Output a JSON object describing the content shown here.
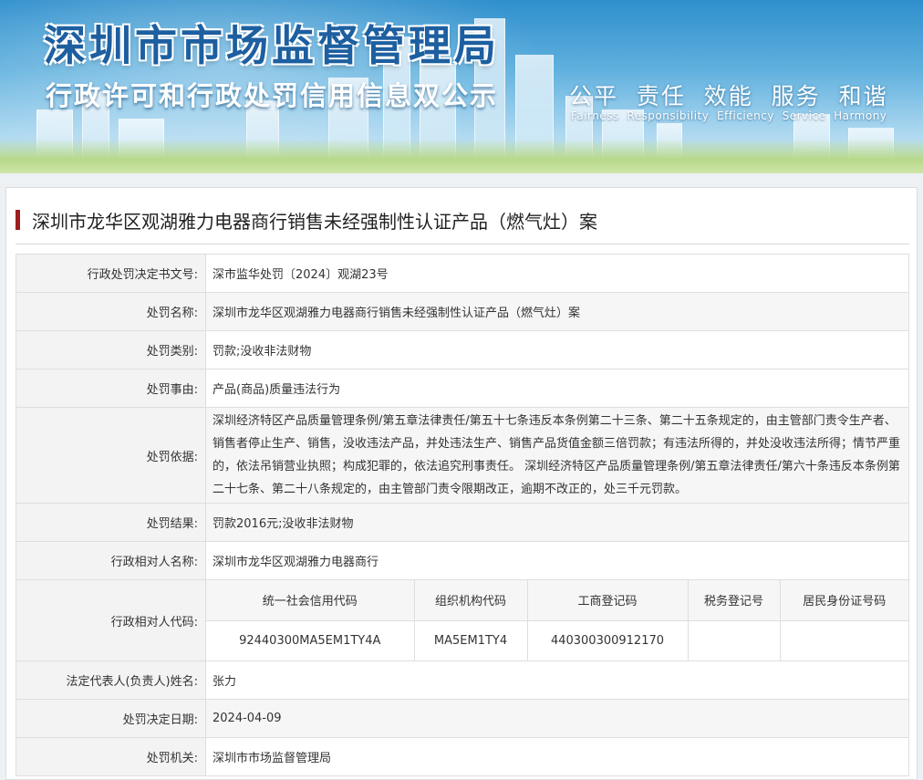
{
  "header": {
    "title": "深圳市市场监督管理局",
    "subtitle": "行政许可和行政处罚信用信息双公示",
    "motto_cn": "公平  责任  效能  服务  和谐",
    "motto_en": "Fairness  Responsibility  Efficiency  Service  Harmony"
  },
  "case": {
    "title": "深圳市龙华区观湖雅力电器商行销售未经强制性认证产品（燃气灶）案"
  },
  "rows": {
    "doc_no": {
      "label": "行政处罚决定书文号:",
      "value": "深市监华处罚〔2024〕观湖23号"
    },
    "name": {
      "label": "处罚名称:",
      "value": "深圳市龙华区观湖雅力电器商行销售未经强制性认证产品（燃气灶）案"
    },
    "type": {
      "label": "处罚类别:",
      "value": "罚款;没收非法财物"
    },
    "reason": {
      "label": "处罚事由:",
      "value": "产品(商品)质量违法行为"
    },
    "basis": {
      "label": "处罚依据:",
      "value": "深圳经济特区产品质量管理条例/第五章法律责任/第五十七条违反本条例第二十三条、第二十五条规定的，由主管部门责令生产者、销售者停止生产、销售，没收违法产品，并处违法生产、销售产品货值金额三倍罚款；有违法所得的，并处没收违法所得；情节严重的，依法吊销营业执照；构成犯罪的，依法追究刑事责任。 深圳经济特区产品质量管理条例/第五章法律责任/第六十条违反本条例第二十七条、第二十八条规定的，由主管部门责令限期改正，逾期不改正的，处三千元罚款。"
    },
    "result": {
      "label": "处罚结果:",
      "value": "罚款2016元;没收非法财物"
    },
    "party": {
      "label": "行政相对人名称:",
      "value": "深圳市龙华区观湖雅力电器商行"
    },
    "codes": {
      "label": "行政相对人代码:",
      "headers": [
        "统一社会信用代码",
        "组织机构代码",
        "工商登记码",
        "税务登记号",
        "居民身份证号码"
      ],
      "values": [
        "92440300MA5EM1TY4A",
        "MA5EM1TY4",
        "440300300912170",
        "",
        ""
      ]
    },
    "legal_rep": {
      "label": "法定代表人(负责人)姓名:",
      "value": "张力"
    },
    "date": {
      "label": "处罚决定日期:",
      "value": "2024-04-09"
    },
    "authority": {
      "label": "处罚机关:",
      "value": "深圳市市场监督管理局"
    }
  }
}
